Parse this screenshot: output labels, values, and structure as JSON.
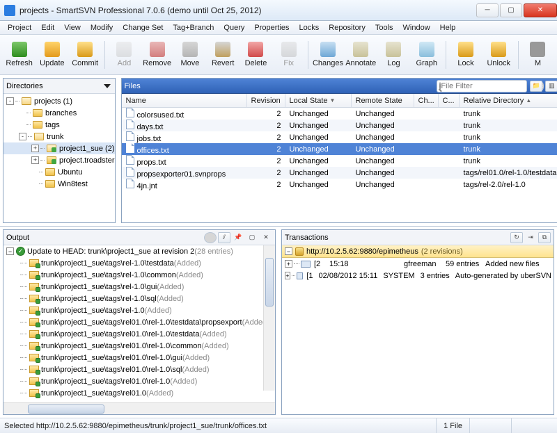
{
  "window": {
    "title": "projects - SmartSVN Professional 7.0.6 (demo until Oct 25, 2012)"
  },
  "menu": [
    "Project",
    "Edit",
    "View",
    "Modify",
    "Change Set",
    "Tag+Branch",
    "Query",
    "Properties",
    "Locks",
    "Repository",
    "Tools",
    "Window",
    "Help"
  ],
  "toolbar": [
    {
      "label": "Refresh",
      "icon": "ic-refresh",
      "enabled": true
    },
    {
      "label": "Update",
      "icon": "ic-update",
      "enabled": true
    },
    {
      "label": "Commit",
      "icon": "ic-commit",
      "enabled": true
    },
    {
      "sep": true
    },
    {
      "label": "Add",
      "icon": "ic-add",
      "enabled": false
    },
    {
      "label": "Remove",
      "icon": "ic-remove",
      "enabled": true
    },
    {
      "label": "Move",
      "icon": "ic-move",
      "enabled": true
    },
    {
      "label": "Revert",
      "icon": "ic-revert",
      "enabled": true
    },
    {
      "label": "Delete",
      "icon": "ic-delete",
      "enabled": true
    },
    {
      "label": "Fix",
      "icon": "ic-fix",
      "enabled": false
    },
    {
      "sep": true
    },
    {
      "label": "Changes",
      "icon": "ic-changes",
      "enabled": true
    },
    {
      "label": "Annotate",
      "icon": "ic-annotate",
      "enabled": true
    },
    {
      "label": "Log",
      "icon": "ic-log",
      "enabled": true
    },
    {
      "label": "Graph",
      "icon": "ic-graph",
      "enabled": true
    },
    {
      "sep": true
    },
    {
      "label": "Lock",
      "icon": "ic-lock",
      "enabled": true
    },
    {
      "label": "Unlock",
      "icon": "ic-unlock",
      "enabled": true
    },
    {
      "sep": true
    },
    {
      "label": "M",
      "icon": "ic-m",
      "enabled": true
    }
  ],
  "directories": {
    "title": "Directories",
    "tree": [
      {
        "depth": 0,
        "exp": "-",
        "label": "projects (1)",
        "open": true
      },
      {
        "depth": 1,
        "exp": "",
        "label": "branches"
      },
      {
        "depth": 1,
        "exp": "",
        "label": "tags"
      },
      {
        "depth": 1,
        "exp": "-",
        "label": "trunk",
        "open": true
      },
      {
        "depth": 2,
        "exp": "+",
        "label": "project1_sue (2)",
        "open": true,
        "sel": true,
        "green": true
      },
      {
        "depth": 2,
        "exp": "+",
        "label": "project.troadster",
        "green": true
      },
      {
        "depth": 2,
        "exp": "",
        "label": "Ubuntu"
      },
      {
        "depth": 2,
        "exp": "",
        "label": "Win8test"
      }
    ]
  },
  "files": {
    "title": "Files",
    "filter_placeholder": "File Filter",
    "columns": [
      "Name",
      "Revision",
      "Local State",
      "Remote State",
      "Ch...",
      "C...",
      "Relative Directory"
    ],
    "rows": [
      {
        "name": "colorsused.txt",
        "rev": "2",
        "ls": "Unchanged",
        "rs": "Unchanged",
        "rd": "trunk"
      },
      {
        "name": "days.txt",
        "rev": "2",
        "ls": "Unchanged",
        "rs": "Unchanged",
        "rd": "trunk"
      },
      {
        "name": "jobs.txt",
        "rev": "2",
        "ls": "Unchanged",
        "rs": "Unchanged",
        "rd": "trunk"
      },
      {
        "name": "offices.txt",
        "rev": "2",
        "ls": "Unchanged",
        "rs": "Unchanged",
        "rd": "trunk",
        "sel": true
      },
      {
        "name": "props.txt",
        "rev": "2",
        "ls": "Unchanged",
        "rs": "Unchanged",
        "rd": "trunk"
      },
      {
        "name": "propsexporter01.svnprops",
        "rev": "2",
        "ls": "Unchanged",
        "rs": "Unchanged",
        "rd": "tags/rel01.0/rel-1.0/testdata"
      },
      {
        "name": "4jn.jnt",
        "rev": "2",
        "ls": "Unchanged",
        "rs": "Unchanged",
        "rd": "tags/rel-2.0/rel-1.0"
      }
    ]
  },
  "output": {
    "title": "Output",
    "head": {
      "text": "Update to HEAD: trunk\\project1_sue at revision 2",
      "suffix": "(28 entries)"
    },
    "entries": [
      "trunk\\project1_sue\\tags\\rel-1.0\\testdata",
      "trunk\\project1_sue\\tags\\rel-1.0\\common",
      "trunk\\project1_sue\\tags\\rel-1.0\\gui",
      "trunk\\project1_sue\\tags\\rel-1.0\\sql",
      "trunk\\project1_sue\\tags\\rel-1.0",
      "trunk\\project1_sue\\tags\\rel01.0\\rel-1.0\\testdata\\propsexport",
      "trunk\\project1_sue\\tags\\rel01.0\\rel-1.0\\testdata",
      "trunk\\project1_sue\\tags\\rel01.0\\rel-1.0\\common",
      "trunk\\project1_sue\\tags\\rel01.0\\rel-1.0\\gui",
      "trunk\\project1_sue\\tags\\rel01.0\\rel-1.0\\sql",
      "trunk\\project1_sue\\tags\\rel01.0\\rel-1.0",
      "trunk\\project1_sue\\tags\\rel01.0"
    ],
    "entry_suffix": "(Added)"
  },
  "transactions": {
    "title": "Transactions",
    "repo": "http://10.2.5.62:9880/epimetheus",
    "repo_suffix": "(2 revisions)",
    "rows": [
      {
        "rev": "[2",
        "time": "15:18",
        "user": "gfreeman",
        "entries": "59 entries",
        "msg": "Added new files"
      },
      {
        "rev": "[1",
        "time": "02/08/2012 15:11",
        "user": "SYSTEM",
        "entries": "3 entries",
        "msg": "Auto-generated by uberSVN"
      }
    ]
  },
  "statusbar": {
    "path": "Selected http://10.2.5.62:9880/epimetheus/trunk/project1_sue/trunk/offices.txt",
    "count": "1 File"
  }
}
